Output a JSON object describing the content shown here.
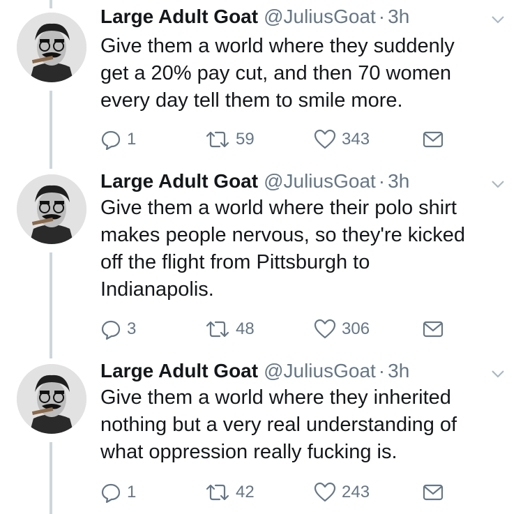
{
  "tweets": [
    {
      "name": "Large Adult Goat",
      "handle": "@JuliusGoat",
      "separator": "·",
      "time": "3h",
      "text": "Give them a world where they suddenly\nget a 20% pay cut, and then 70 women\nevery day tell them to smile more.",
      "replies": "1",
      "retweets": "59",
      "likes": "343",
      "icons": {
        "reply": "reply-icon",
        "retweet": "retweet-icon",
        "like": "heart-icon",
        "dm": "envelope-icon",
        "caret": "chevron-down-icon"
      }
    },
    {
      "name": "Large Adult Goat",
      "handle": "@JuliusGoat",
      "separator": "·",
      "time": "3h",
      "text": "Give them a world where their polo shirt\nmakes people nervous, so they're kicked\noff the flight from Pittsburgh to\nIndianapolis.",
      "replies": "3",
      "retweets": "48",
      "likes": "306",
      "icons": {
        "reply": "reply-icon",
        "retweet": "retweet-icon",
        "like": "heart-icon",
        "dm": "envelope-icon",
        "caret": "chevron-down-icon"
      }
    },
    {
      "name": "Large Adult Goat",
      "handle": "@JuliusGoat",
      "separator": "·",
      "time": "3h",
      "text": "Give them a world where they inherited\nnothing but a very real understanding of\nwhat oppression really fucking is.",
      "replies": "1",
      "retweets": "42",
      "likes": "243",
      "icons": {
        "reply": "reply-icon",
        "retweet": "retweet-icon",
        "like": "heart-icon",
        "dm": "envelope-icon",
        "caret": "chevron-down-icon"
      }
    }
  ],
  "colors": {
    "text": "#14171a",
    "muted": "#657786",
    "thread_line": "#ccd6dd"
  }
}
